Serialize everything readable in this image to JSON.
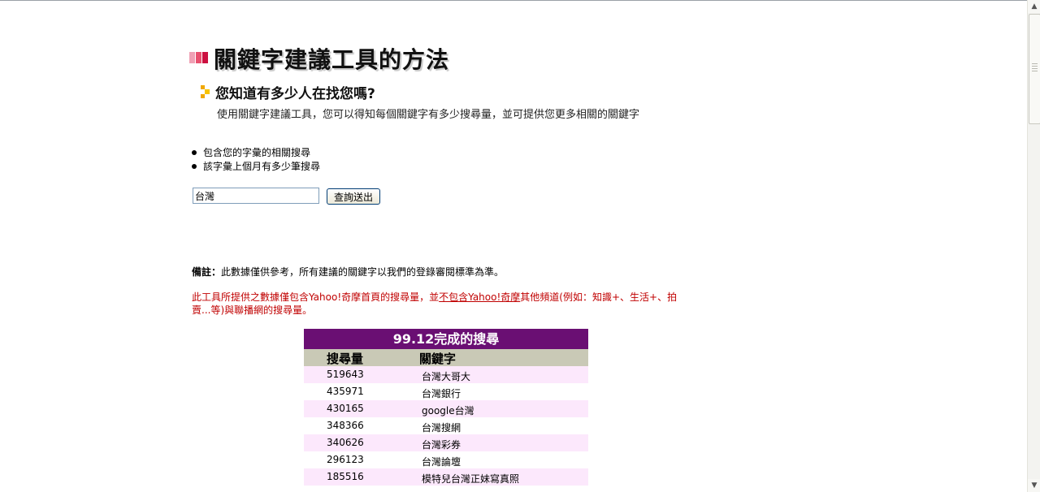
{
  "page": {
    "title": "關鍵字建議工具的方法",
    "subtitle": "您知道有多少人在找您嗎?",
    "description": "使用關鍵字建議工具，您可以得知每個關鍵字有多少搜尋量，並可提供您更多相關的關鍵字"
  },
  "bullets": [
    "包含您的字彙的相關搜尋",
    "該字彙上個月有多少筆搜尋"
  ],
  "search": {
    "value": "台灣",
    "button_label": "查詢送出"
  },
  "note": {
    "label": "備註：",
    "text": "此數據僅供參考，所有建議的關鍵字以我們的登錄審閱標準為準。"
  },
  "red_note": {
    "part1": "此工具所提供之數據僅包含Yahoo!奇摩首頁的搜尋量，並",
    "underlined": "不包含Yahoo!奇摩",
    "part2": "其他頻道(例如：知識+、生活+、拍賣...等)與聯播網的搜尋量。"
  },
  "results": {
    "header": "99.12完成的搜尋",
    "col_volume": "搜尋量",
    "col_keyword": "關鍵字",
    "rows": [
      {
        "volume": "519643",
        "keyword": "台灣大哥大"
      },
      {
        "volume": "435971",
        "keyword": "台灣銀行"
      },
      {
        "volume": "430165",
        "keyword": "google台灣"
      },
      {
        "volume": "348366",
        "keyword": "台灣搜網"
      },
      {
        "volume": "340626",
        "keyword": "台灣彩券"
      },
      {
        "volume": "296123",
        "keyword": "台灣論壇"
      },
      {
        "volume": "185516",
        "keyword": "模特兒台灣正妹寫真照"
      }
    ]
  },
  "colors": {
    "header_bg": "#6a0f73",
    "column_bg": "#c9c9b6",
    "row_alt_bg": "#fce8fc",
    "note_red": "#c00000"
  }
}
